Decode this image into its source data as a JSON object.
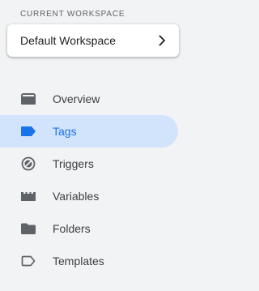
{
  "workspace": {
    "section_label": "CURRENT WORKSPACE",
    "name": "Default Workspace",
    "chevron_icon": "chevron-right-icon"
  },
  "nav": {
    "items": [
      {
        "label": "Overview",
        "icon": "overview-icon"
      },
      {
        "label": "Tags",
        "icon": "tag-icon",
        "active": true
      },
      {
        "label": "Triggers",
        "icon": "trigger-icon"
      },
      {
        "label": "Variables",
        "icon": "variables-icon"
      },
      {
        "label": "Folders",
        "icon": "folder-icon"
      },
      {
        "label": "Templates",
        "icon": "templates-icon"
      }
    ]
  },
  "colors": {
    "background": "#f1f3f4",
    "active_bg": "#d2e3fc",
    "active_accent": "#1a73e8",
    "icon_gray": "#5f6368",
    "text": "#3c4043"
  }
}
